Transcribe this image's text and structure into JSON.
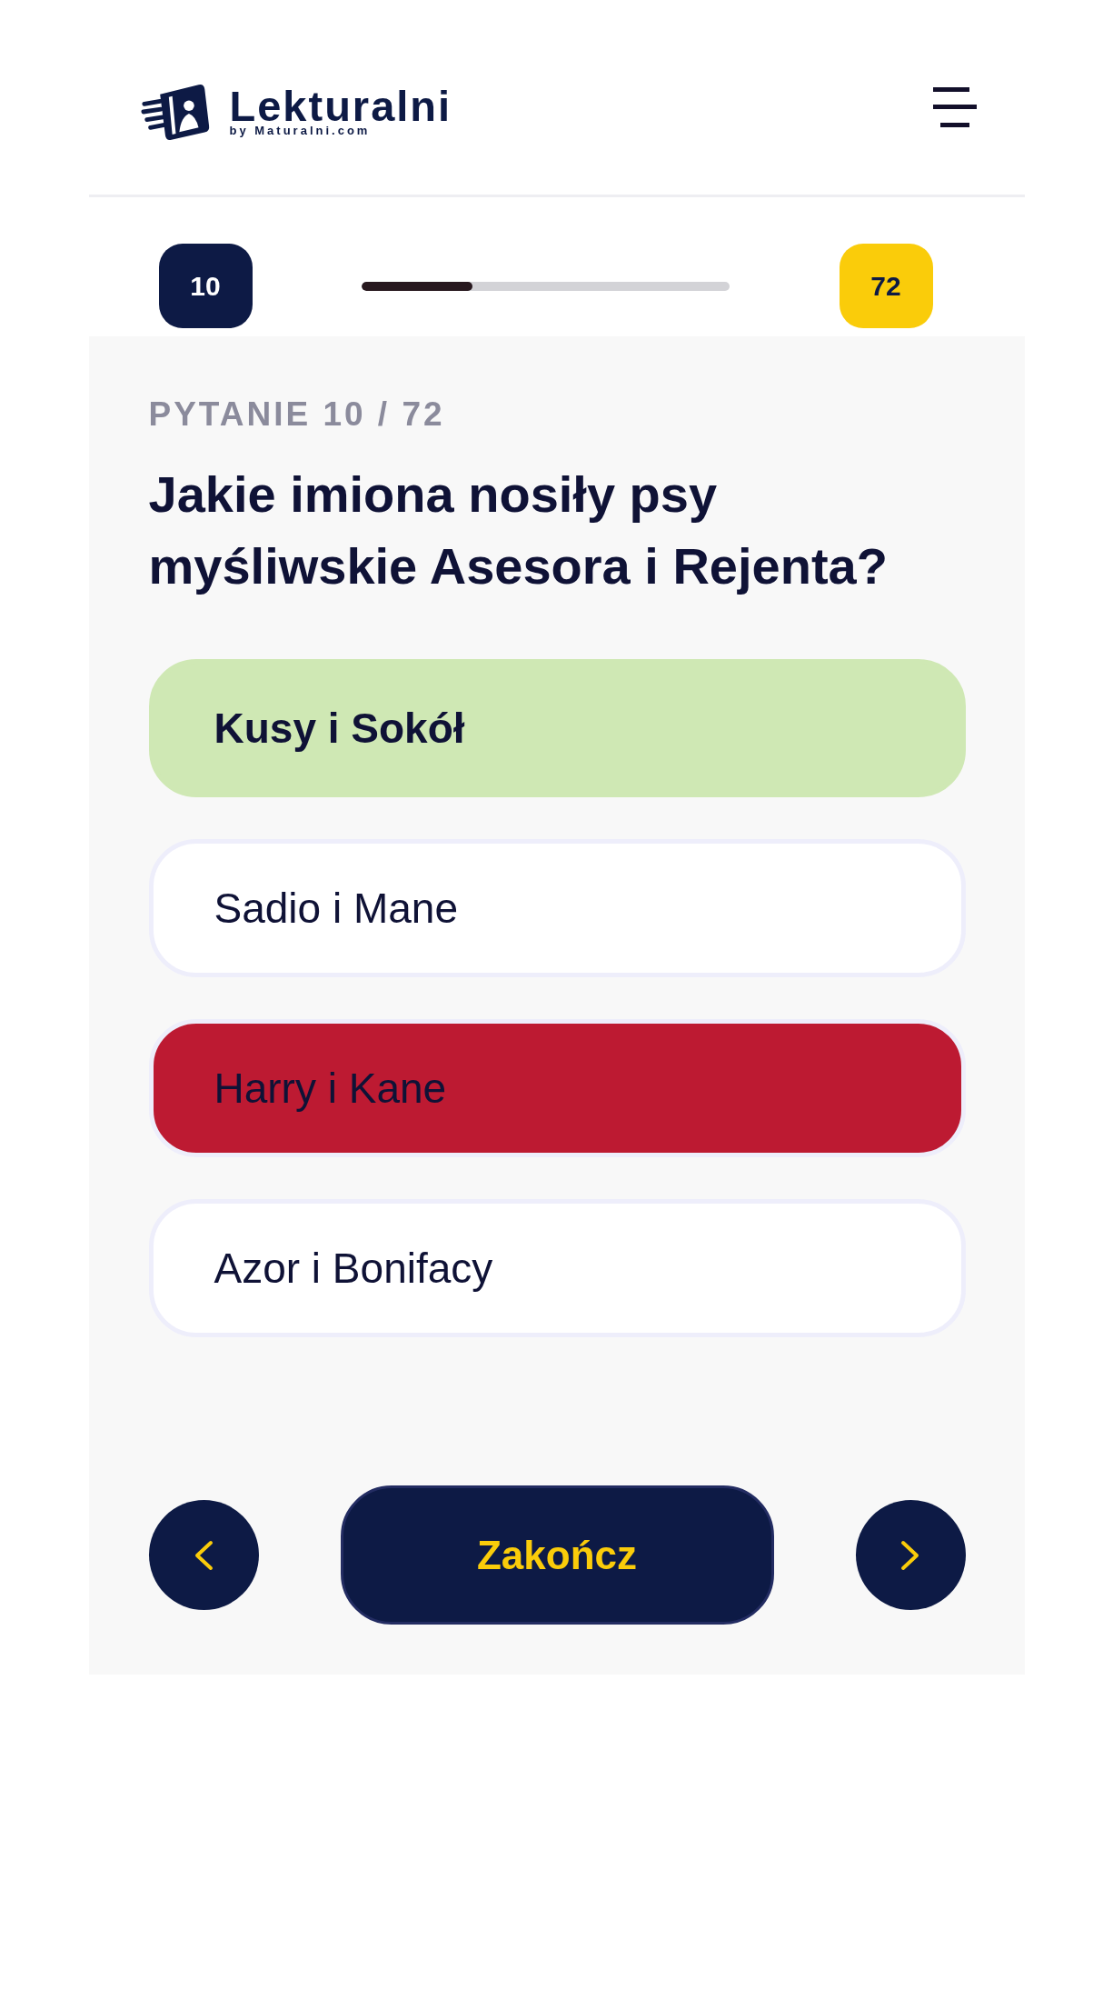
{
  "header": {
    "logo": {
      "name": "Lekturalni",
      "tagline": "by Maturalni.com"
    }
  },
  "progress": {
    "current": "10",
    "total": "72",
    "level": 0.3
  },
  "question": {
    "label": "PYTANIE 10 / 72",
    "text": "Jakie imiona nosiły psy myśliwskie Asesora i Rejenta?"
  },
  "answers": [
    {
      "text": "Kusy i Sokół",
      "correct": true,
      "selected": false
    },
    {
      "text": "Sadio i Mane",
      "correct": false,
      "selected": false
    },
    {
      "text": "Harry i Kane",
      "correct": false,
      "selected": true
    },
    {
      "text": "Azor i Bonifacy",
      "correct": false,
      "selected": false
    }
  ],
  "navigation": {
    "finish_label": "Zakończ"
  }
}
